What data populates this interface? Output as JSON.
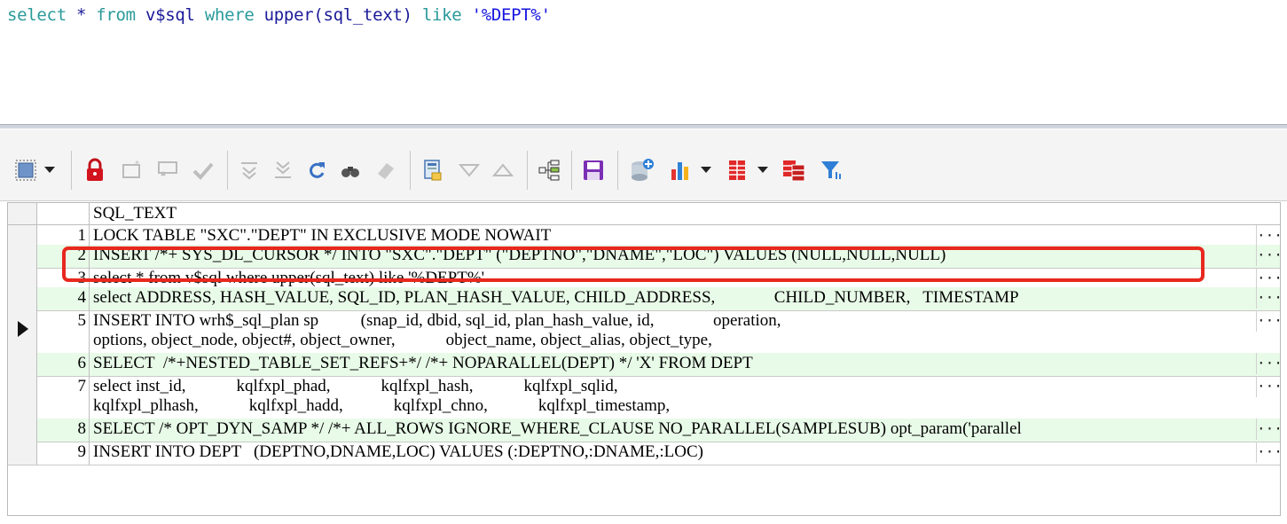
{
  "editor": {
    "sql_parts": {
      "p1": "select",
      "p2": " * ",
      "p3": "from",
      "p4": " v$sql ",
      "p5": "where",
      "p6": " upper(sql_text) ",
      "p7": "like",
      "p8": " ",
      "p9": "'%DEPT%'"
    }
  },
  "toolbar": {
    "icons": [
      "select-all-icon",
      "dropdown-arrow-icon",
      "lock-icon",
      "new-record-icon",
      "comment-icon",
      "check-icon",
      "down-first-icon",
      "down-last-icon",
      "refresh-icon",
      "find-icon",
      "eraser-icon",
      "export-icon",
      "sort-down-icon",
      "sort-up-icon",
      "tree-icon",
      "save-icon",
      "database-icon",
      "bar-chart-icon",
      "dropdown-arrow-icon",
      "grid-red-icon",
      "dropdown-arrow-icon",
      "copy-red-icon",
      "filter-icon"
    ]
  },
  "grid": {
    "column_header": "SQL_TEXT",
    "more_glyph": "···",
    "rows": [
      {
        "n": "1",
        "l1": "LOCK TABLE \"SXC\".\"DEPT\" IN EXCLUSIVE MODE NOWAIT",
        "l2": ""
      },
      {
        "n": "2",
        "l1": "INSERT /*+ SYS_DL_CURSOR */ INTO \"SXC\".\"DEPT\" (\"DEPTNO\",\"DNAME\",\"LOC\") VALUES (NULL,NULL,NULL)",
        "l2": ""
      },
      {
        "n": "3",
        "l1": "select * from v$sql where upper(sql_text) like '%DEPT%'",
        "l2": ""
      },
      {
        "n": "4",
        "l1": "select ADDRESS, HASH_VALUE, SQL_ID, PLAN_HASH_VALUE, CHILD_ADDRESS,              CHILD_NUMBER,   TIMESTAMP",
        "l2": ""
      },
      {
        "n": "5",
        "l1": "INSERT INTO wrh$_sql_plan sp          (snap_id, dbid, sql_id, plan_hash_value, id,              operation,",
        "l2": "options, object_node, object#, object_owner,            object_name, object_alias, object_type,"
      },
      {
        "n": "6",
        "l1": "SELECT  /*+NESTED_TABLE_SET_REFS+*/ /*+ NOPARALLEL(DEPT) */ 'X' FROM DEPT",
        "l2": ""
      },
      {
        "n": "7",
        "l1": "select inst_id,            kqlfxpl_phad,            kqlfxpl_hash,            kqlfxpl_sqlid,",
        "l2": "kqlfxpl_plhash,            kqlfxpl_hadd,            kqlfxpl_chno,            kqlfxpl_timestamp,"
      },
      {
        "n": "8",
        "l1": "SELECT /* OPT_DYN_SAMP */ /*+ ALL_ROWS IGNORE_WHERE_CLAUSE NO_PARALLEL(SAMPLESUB) opt_param('parallel",
        "l2": ""
      },
      {
        "n": "9",
        "l1": "INSERT INTO DEPT   (DEPTNO,DNAME,LOC) VALUES (:DEPTNO,:DNAME,:LOC)",
        "l2": ""
      }
    ]
  },
  "colors": {
    "row_alt": "#e8fbe8",
    "highlight": "#e8281e",
    "keyword": "#2a9a9a",
    "string": "#1515e0"
  }
}
